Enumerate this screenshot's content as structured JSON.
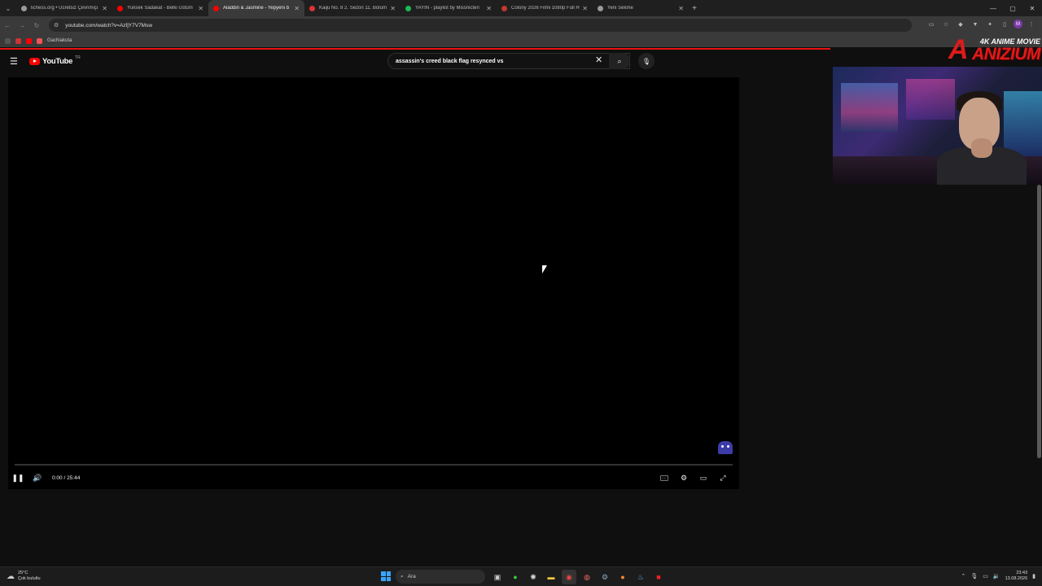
{
  "browser": {
    "tabs": [
      {
        "title": "lichess.org • Ücretsiz Çevrimiçi",
        "favicon_color": "#9a9a9a",
        "active": false
      },
      {
        "title": "Yüksek Sadakat - Belki Üstüm",
        "favicon_color": "#ff0000",
        "active": false
      },
      {
        "title": "Aladdin & Jasmine - Yepyeni b",
        "favicon_color": "#ff0000",
        "active": true
      },
      {
        "title": "Kaiju No. 8 2. Sezon 11. Bölüm",
        "favicon_color": "#d33",
        "active": false
      },
      {
        "title": "YAYIN - playlist by Missnicteri",
        "favicon_color": "#1db954",
        "active": false
      },
      {
        "title": "Colony 2026 Filmi 1080p Full H",
        "favicon_color": "#c0392b",
        "active": false
      },
      {
        "title": "Yeni Sekme",
        "favicon_color": "#9a9a9a",
        "active": false
      }
    ],
    "url": "youtube.com/watch?v=AzfjY7V7Msw",
    "bookmark": "Gachiakuta",
    "profile_initial": "M"
  },
  "youtube": {
    "logo_text": "YouTube",
    "country_code": "TR",
    "search_query": "assassin's creed black flag resynced vs"
  },
  "player": {
    "time_display": "0:00 / 25:44",
    "progress_fraction": 0.0
  },
  "overlay": {
    "brand_top": "4K ANIME MOVIE",
    "brand_name": "ANIZIUM",
    "brand_letter": "A"
  },
  "taskbar": {
    "weather_temp": "25°C",
    "weather_desc": "Çok bulutlu",
    "search_label": "Ara",
    "time": "23:43",
    "date": "13.08.2026"
  }
}
